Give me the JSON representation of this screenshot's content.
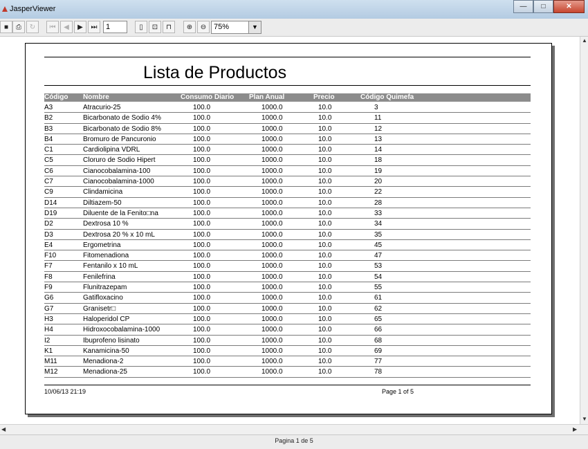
{
  "window": {
    "title": "JasperViewer",
    "min": "—",
    "max": "□",
    "close": "✕"
  },
  "toolbar": {
    "save_icon": "■",
    "print_icon": "⎙",
    "reload_icon": "↻",
    "first_icon": "⏮",
    "prev_icon": "◀",
    "next_icon": "▶",
    "last_icon": "⏭",
    "page_number": "1",
    "actual_size_icon": "▯",
    "fit_page_icon": "⊡",
    "fit_width_icon": "⊓",
    "zoom_in_icon": "⊕",
    "zoom_out_icon": "⊖",
    "zoom_value": "75%",
    "zoom_arrow": "▼"
  },
  "report": {
    "title": "Lista de Productos",
    "columns": [
      "Código",
      "Nombre",
      "Consumo Diario",
      "Plan Anual",
      "Precio",
      "Código Quimefa"
    ],
    "rows": [
      [
        "A3",
        "Atracurio-25",
        "100.0",
        "1000.0",
        "10.0",
        "3"
      ],
      [
        "B2",
        "Bicarbonato de Sodio 4%",
        "100.0",
        "1000.0",
        "10.0",
        "11"
      ],
      [
        "B3",
        "Bicarbonato de Sodio 8%",
        "100.0",
        "1000.0",
        "10.0",
        "12"
      ],
      [
        "B4",
        "Bromuro de Pancuronio",
        "100.0",
        "1000.0",
        "10.0",
        "13"
      ],
      [
        "C1",
        "Cardiolipina VDRL",
        "100.0",
        "1000.0",
        "10.0",
        "14"
      ],
      [
        "C5",
        "Cloruro de Sodio Hipert",
        "100.0",
        "1000.0",
        "10.0",
        "18"
      ],
      [
        "C6",
        "Cianocobalamina-100",
        "100.0",
        "1000.0",
        "10.0",
        "19"
      ],
      [
        "C7",
        "Cianocobalamina-1000",
        "100.0",
        "1000.0",
        "10.0",
        "20"
      ],
      [
        "C9",
        "Clindamicina",
        "100.0",
        "1000.0",
        "10.0",
        "22"
      ],
      [
        "D14",
        "Diltiazem-50",
        "100.0",
        "1000.0",
        "10.0",
        "28"
      ],
      [
        "D19",
        "Diluente de la Fenito□na",
        "100.0",
        "1000.0",
        "10.0",
        "33"
      ],
      [
        "D2",
        "Dextrosa 10 %",
        "100.0",
        "1000.0",
        "10.0",
        "34"
      ],
      [
        "D3",
        "Dextrosa 20 % x 10 mL",
        "100.0",
        "1000.0",
        "10.0",
        "35"
      ],
      [
        "E4",
        "Ergometrina",
        "100.0",
        "1000.0",
        "10.0",
        "45"
      ],
      [
        "F10",
        "Fitomenadiona",
        "100.0",
        "1000.0",
        "10.0",
        "47"
      ],
      [
        "F7",
        "Fentanilo x 10 mL",
        "100.0",
        "1000.0",
        "10.0",
        "53"
      ],
      [
        "F8",
        "Fenilefrina",
        "100.0",
        "1000.0",
        "10.0",
        "54"
      ],
      [
        "F9",
        "Flunitrazepam",
        "100.0",
        "1000.0",
        "10.0",
        "55"
      ],
      [
        "G6",
        "Gatifloxacino",
        "100.0",
        "1000.0",
        "10.0",
        "61"
      ],
      [
        "G7",
        "Granisetr□",
        "100.0",
        "1000.0",
        "10.0",
        "62"
      ],
      [
        "H3",
        "Haloperidol CP",
        "100.0",
        "1000.0",
        "10.0",
        "65"
      ],
      [
        "H4",
        "Hidroxocobalamina-1000",
        "100.0",
        "1000.0",
        "10.0",
        "66"
      ],
      [
        "I2",
        "Ibuprofeno lisinato",
        "100.0",
        "1000.0",
        "10.0",
        "68"
      ],
      [
        "K1",
        "Kanamicina-50",
        "100.0",
        "1000.0",
        "10.0",
        "69"
      ],
      [
        "M11",
        "Menadiona-2",
        "100.0",
        "1000.0",
        "10.0",
        "77"
      ],
      [
        "M12",
        "Menadiona-25",
        "100.0",
        "1000.0",
        "10.0",
        "78"
      ]
    ],
    "footer_date": "10/06/13 21:19",
    "footer_page": "Page 1 of 5"
  },
  "status": {
    "text": "Pagina 1 de 5"
  },
  "scroll": {
    "up": "▲",
    "down": "▼",
    "left": "◀",
    "right": "▶"
  }
}
